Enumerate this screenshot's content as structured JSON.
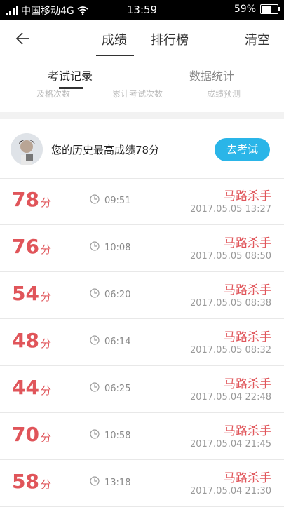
{
  "status_bar": {
    "carrier": "中国移动4G",
    "time": "13:59",
    "battery": "59%",
    "battery_level": 0.59
  },
  "nav": {
    "tabs": [
      {
        "label": "成绩"
      },
      {
        "label": "排行榜"
      }
    ],
    "clear_label": "清空"
  },
  "subtabs": [
    {
      "label": "考试记录"
    },
    {
      "label": "数据统计"
    }
  ],
  "stats_labels": [
    "及格次数",
    "累计考试次数",
    "成绩预测"
  ],
  "best": {
    "text": "您的历史最高成绩78分",
    "button": "去考试"
  },
  "records": [
    {
      "score": "78",
      "unit": "分",
      "duration": "09:51",
      "title": "马路杀手",
      "date": "2017.05.05  13:27"
    },
    {
      "score": "76",
      "unit": "分",
      "duration": "10:08",
      "title": "马路杀手",
      "date": "2017.05.05  08:50"
    },
    {
      "score": "54",
      "unit": "分",
      "duration": "06:20",
      "title": "马路杀手",
      "date": "2017.05.05  08:38"
    },
    {
      "score": "48",
      "unit": "分",
      "duration": "06:14",
      "title": "马路杀手",
      "date": "2017.05.05  08:32"
    },
    {
      "score": "44",
      "unit": "分",
      "duration": "06:25",
      "title": "马路杀手",
      "date": "2017.05.04  22:48"
    },
    {
      "score": "70",
      "unit": "分",
      "duration": "10:58",
      "title": "马路杀手",
      "date": "2017.05.04  21:45"
    },
    {
      "score": "58",
      "unit": "分",
      "duration": "13:18",
      "title": "马路杀手",
      "date": "2017.05.04  21:30"
    }
  ],
  "colors": {
    "accent_red": "#e0555a",
    "button_blue": "#2ab5e8"
  }
}
